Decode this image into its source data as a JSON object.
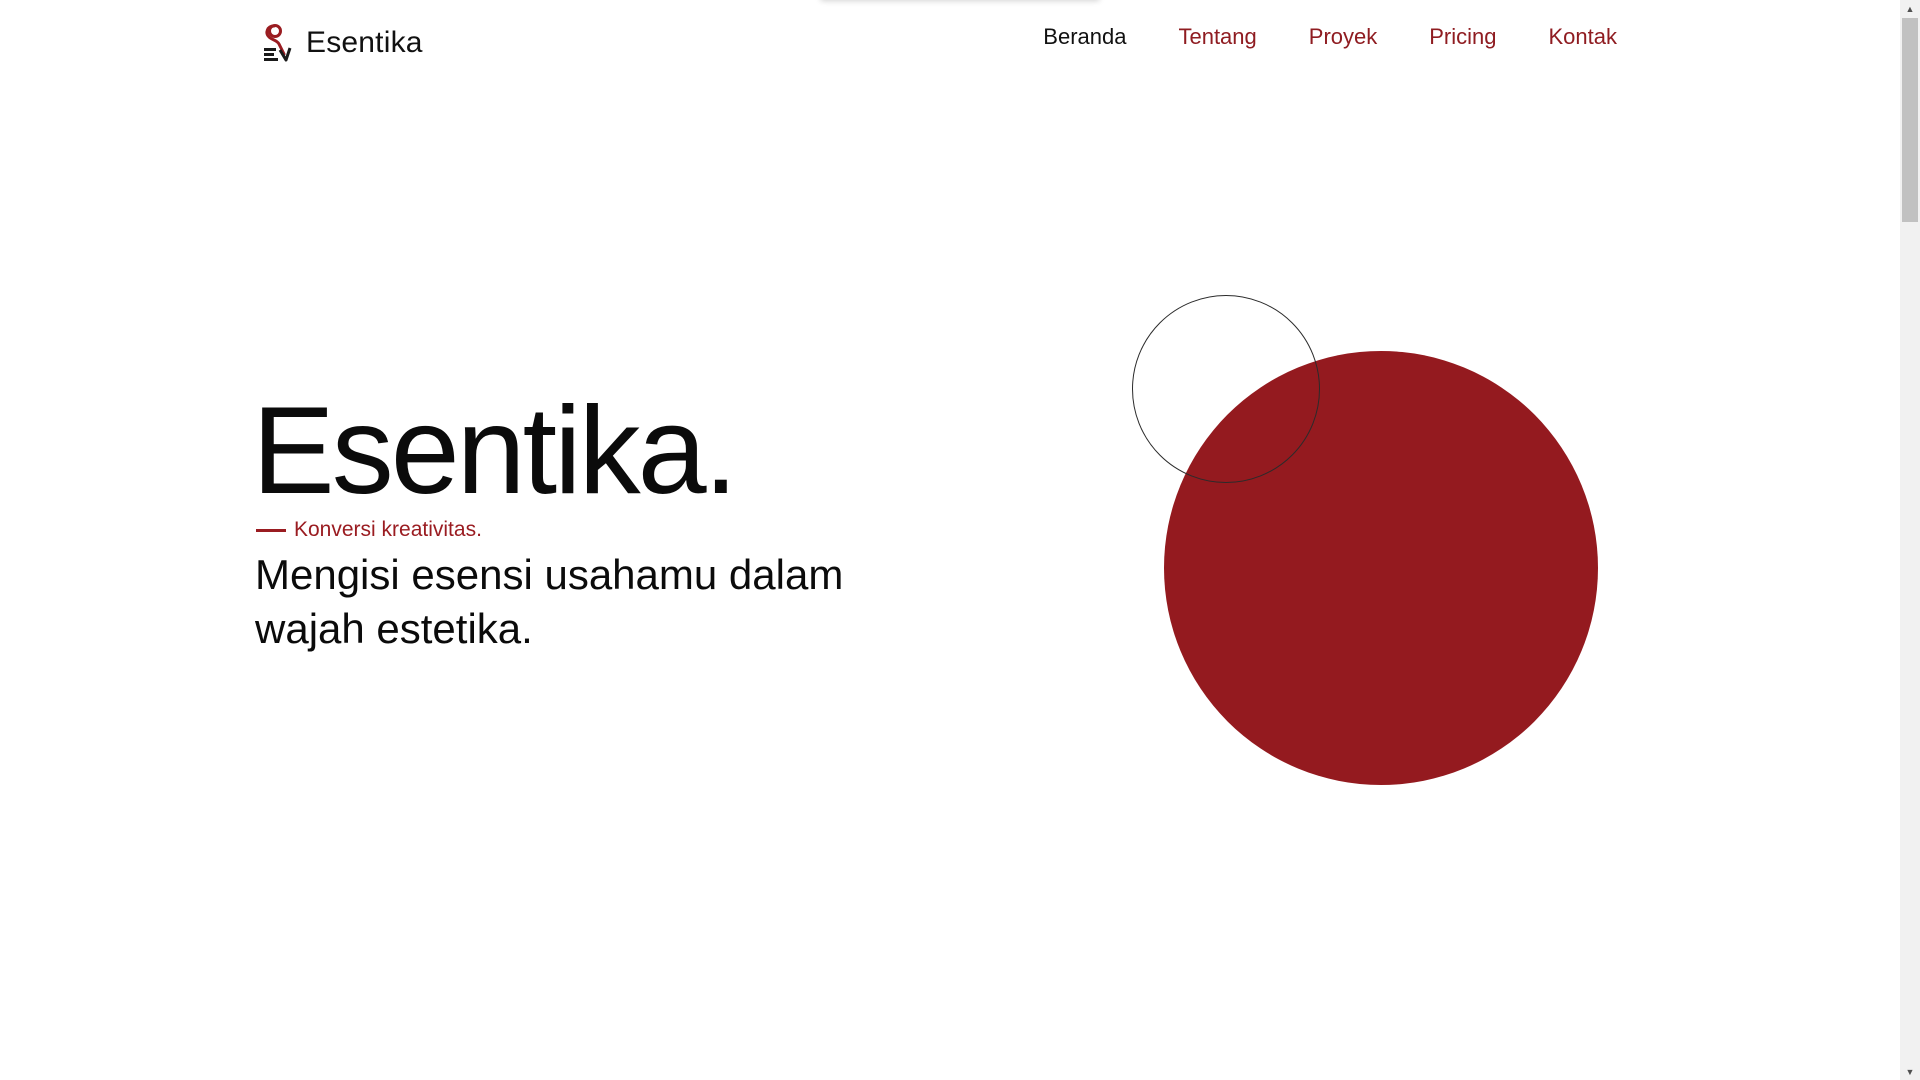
{
  "header": {
    "brand_name": "Esentika",
    "logo_icon": "esentika-logo-icon",
    "nav": [
      {
        "label": "Beranda",
        "active": true
      },
      {
        "label": "Tentang",
        "active": false
      },
      {
        "label": "Proyek",
        "active": false
      },
      {
        "label": "Pricing",
        "active": false
      },
      {
        "label": "Kontak",
        "active": false
      }
    ]
  },
  "hero": {
    "title": "Esentika.",
    "tagline": "Konversi kreativitas.",
    "subtitle": "Mengisi esensi usahamu dalam wajah estetika."
  },
  "colors": {
    "accent": "#941a1f",
    "text": "#0b0b0b",
    "background": "#ffffff"
  }
}
